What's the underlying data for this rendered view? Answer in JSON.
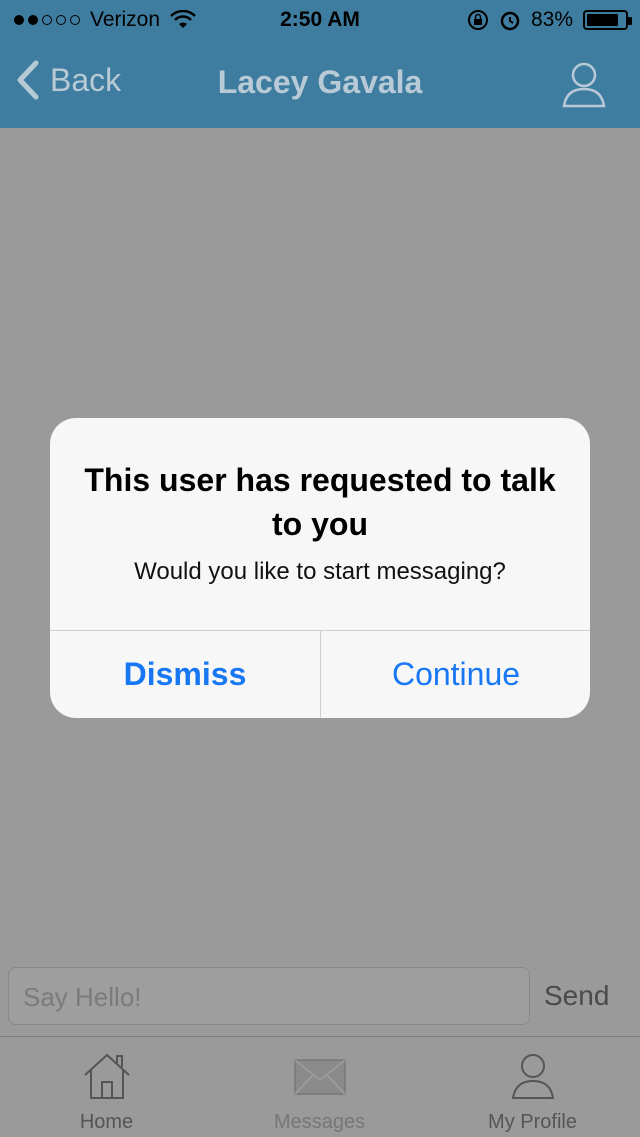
{
  "status_bar": {
    "carrier": "Verizon",
    "time": "2:50 AM",
    "battery": "83%",
    "battery_level": 0.83,
    "signal_bars_filled": 2,
    "signal_bars_total": 5
  },
  "nav": {
    "back_label": "Back",
    "title": "Lacey Gavala",
    "right_icon": "person-icon"
  },
  "dialog": {
    "title": "This user has requested to talk to you",
    "message": "Would you like to start messaging?",
    "dismiss_label": "Dismiss",
    "continue_label": "Continue"
  },
  "composer": {
    "placeholder": "Say Hello!",
    "send_label": "Send"
  },
  "tabs": [
    {
      "label": "Home",
      "icon": "home-icon"
    },
    {
      "label": "Messages",
      "icon": "envelope-icon"
    },
    {
      "label": "My Profile",
      "icon": "person-icon"
    }
  ],
  "colors": {
    "nav_bar": "#3f7da0",
    "accent": "#1877f2",
    "overlay": "#9a9a9a"
  }
}
